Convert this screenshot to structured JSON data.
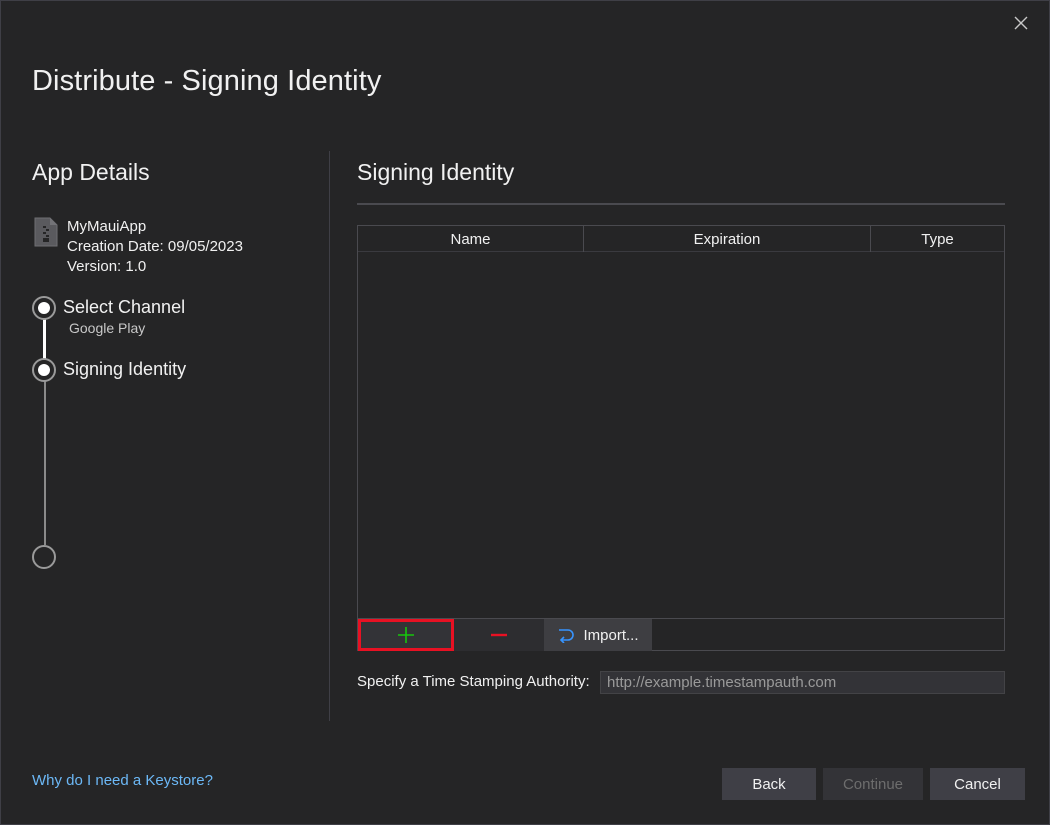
{
  "window": {
    "title": "Distribute - Signing Identity"
  },
  "left_panel": {
    "heading": "App Details",
    "app": {
      "name": "MyMauiApp",
      "creation_date": "Creation Date: 09/05/2023",
      "version": "Version: 1.0",
      "icon": "zip-file-icon"
    },
    "steps": [
      {
        "label": "Select Channel",
        "sublabel": "Google Play",
        "state": "completed"
      },
      {
        "label": "Signing Identity",
        "sublabel": "",
        "state": "current"
      },
      {
        "label": "",
        "sublabel": "",
        "state": "pending"
      }
    ]
  },
  "right_panel": {
    "heading": "Signing Identity",
    "table": {
      "columns": [
        "Name",
        "Expiration",
        "Type"
      ],
      "rows": []
    },
    "toolbar": {
      "add_icon": "plus-icon",
      "add_color": "#16c60c",
      "remove_icon": "minus-icon",
      "remove_color": "#e81123",
      "import_icon": "import-arrow-icon",
      "import_color": "#3794ff",
      "import_label": "Import..."
    },
    "tsa": {
      "label": "Specify a Time Stamping Authority:",
      "value": "",
      "placeholder": "http://example.timestampauth.com"
    }
  },
  "footer": {
    "help_link": "Why do I need a Keystore?",
    "back_label": "Back",
    "continue_label": "Continue",
    "cancel_label": "Cancel"
  },
  "colors": {
    "background": "#252526",
    "link": "#6cb8f6",
    "highlight_border": "#e81123"
  }
}
